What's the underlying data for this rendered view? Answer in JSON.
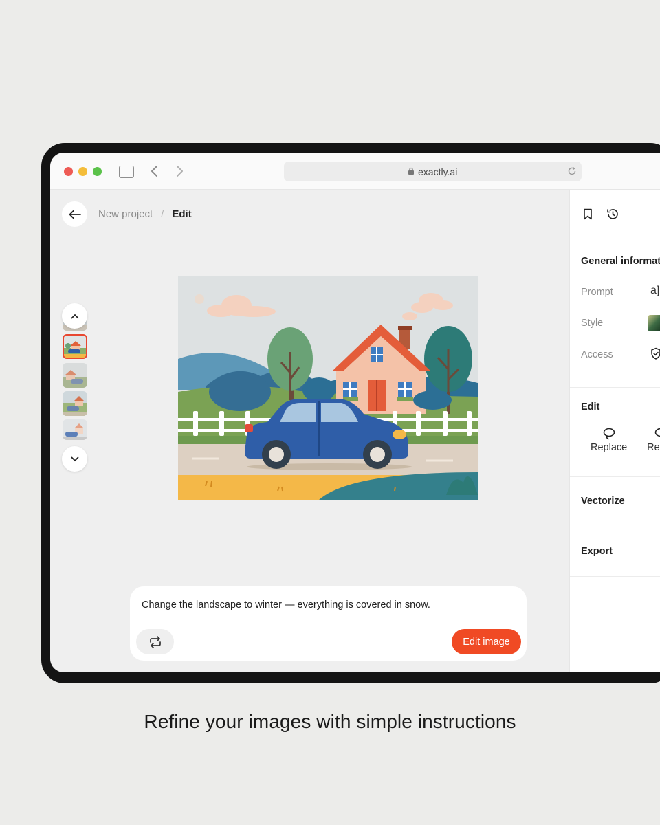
{
  "browser": {
    "url": "exactly.ai"
  },
  "editor": {
    "breadcrumb": {
      "parent": "New project",
      "separator": "/",
      "current": "Edit"
    },
    "prompt": {
      "text": "Change the landscape to winter — everything is covered in snow.",
      "submit_label": "Edit image"
    }
  },
  "panel": {
    "general_title": "General informat",
    "fields": [
      {
        "label": "Prompt",
        "value": "a]"
      },
      {
        "label": "Style"
      },
      {
        "label": "Access"
      }
    ],
    "edit_title": "Edit",
    "edit_actions": [
      {
        "label": "Replace"
      },
      {
        "label": "Rec"
      }
    ],
    "vectorize_title": "Vectorize",
    "export_title": "Export"
  },
  "caption": "Refine your images with simple instructions",
  "colors": {
    "accent": "#f04a24",
    "active_thumb_border": "#e8462f",
    "car": "#2f5ea8"
  }
}
